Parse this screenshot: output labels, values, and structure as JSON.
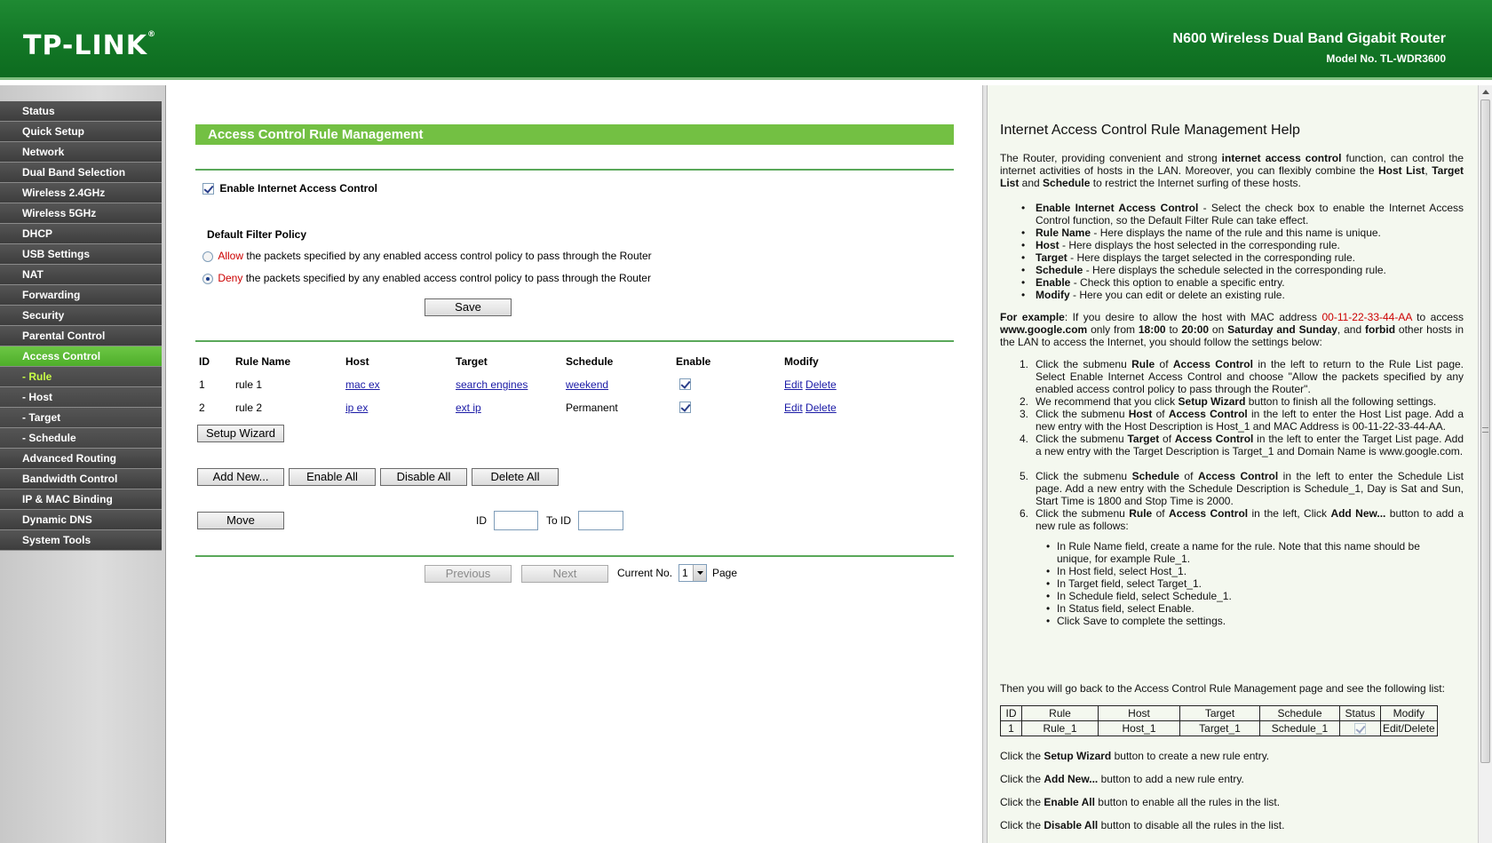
{
  "header": {
    "logo": "TP-LINK",
    "logo_mark": "®",
    "product": "N600 Wireless Dual Band Gigabit Router",
    "model": "Model No. TL-WDR3600"
  },
  "sidebar": {
    "items": [
      {
        "label": "Status"
      },
      {
        "label": "Quick Setup"
      },
      {
        "label": "Network"
      },
      {
        "label": "Dual Band Selection"
      },
      {
        "label": "Wireless 2.4GHz"
      },
      {
        "label": "Wireless 5GHz"
      },
      {
        "label": "DHCP"
      },
      {
        "label": "USB Settings"
      },
      {
        "label": "NAT"
      },
      {
        "label": "Forwarding"
      },
      {
        "label": "Security"
      },
      {
        "label": "Parental Control"
      },
      {
        "label": "Access Control"
      },
      {
        "label": "- Rule"
      },
      {
        "label": "- Host"
      },
      {
        "label": "- Target"
      },
      {
        "label": "- Schedule"
      },
      {
        "label": "Advanced Routing"
      },
      {
        "label": "Bandwidth Control"
      },
      {
        "label": "IP & MAC Binding"
      },
      {
        "label": "Dynamic DNS"
      },
      {
        "label": "System Tools"
      }
    ]
  },
  "main": {
    "title": "Access Control Rule Management",
    "enable_label": "Enable Internet Access Control",
    "enable_checked": true,
    "policy_heading": "Default Filter Policy",
    "allow_word": "Allow",
    "allow_text": " the packets specified by any enabled access control policy to pass through the Router",
    "deny_word": "Deny",
    "deny_text": " the packets specified by any enabled access control policy to pass through the Router",
    "policy_selected": "deny",
    "save_label": "Save",
    "table": {
      "headers": [
        "ID",
        "Rule Name",
        "Host",
        "Target",
        "Schedule",
        "Enable",
        "Modify"
      ],
      "rows": [
        {
          "id": "1",
          "rule": "rule 1",
          "host": "mac ex",
          "target": "search engines",
          "schedule": "weekend",
          "schedule_link": true,
          "enabled": true,
          "edit": "Edit",
          "delete": "Delete"
        },
        {
          "id": "2",
          "rule": "rule 2",
          "host": "ip ex",
          "target": "ext ip",
          "schedule": "Permanent",
          "schedule_link": false,
          "enabled": true,
          "edit": "Edit",
          "delete": "Delete"
        }
      ]
    },
    "setup_wizard_label": "Setup Wizard",
    "add_new_label": "Add New...",
    "enable_all_label": "Enable All",
    "disable_all_label": "Disable All",
    "delete_all_label": "Delete All",
    "move_label": "Move",
    "id_label": "ID",
    "to_id_label": "To ID",
    "previous_label": "Previous",
    "next_label": "Next",
    "current_no_label": "Current No.",
    "current_page": "1",
    "page_label": "Page"
  },
  "help": {
    "title": "Internet Access Control Rule Management Help",
    "intro_1": "The Router, providing convenient and strong ",
    "intro_b1": "internet access control",
    "intro_2": " function, can control the internet activities of hosts in the LAN. Moreover, you can flexibly combine the ",
    "intro_b2": "Host List",
    "intro_3": ", ",
    "intro_b3": "Target List",
    "intro_4": " and ",
    "intro_b4": "Schedule",
    "intro_5": " to restrict the Internet surfing of these hosts.",
    "bullets": [
      {
        "b": "Enable Internet Access Control",
        "t": " - Select the check box to enable the Internet Access Control function, so the Default Filter Rule can take effect."
      },
      {
        "b": "Rule Name",
        "t": " - Here displays the name of the rule and this name is unique."
      },
      {
        "b": "Host",
        "t": " - Here displays the host selected in the corresponding rule."
      },
      {
        "b": "Target",
        "t": " - Here displays the target selected in the corresponding rule."
      },
      {
        "b": "Schedule",
        "t": " - Here displays the schedule selected in the corresponding rule."
      },
      {
        "b": "Enable",
        "t": " - Check this option to enable a specific entry."
      },
      {
        "b": "Modify",
        "t": " - Here you can edit or delete an existing rule."
      }
    ],
    "example_b": "For example",
    "example_1": ": If you desire to allow the host with MAC address ",
    "example_mac": "00-11-22-33-44-AA",
    "example_2": " to access ",
    "example_b2": "www.google.com",
    "example_3": " only from ",
    "example_b3": "18:00",
    "example_4": " to ",
    "example_b4": "20:00",
    "example_5": " on ",
    "example_b5": "Saturday and Sunday",
    "example_6": ", and ",
    "example_b6": "forbid",
    "example_7": " other hosts in the LAN to access the Internet, you should follow the settings below:",
    "steps": [
      {
        "a": "Click the submenu ",
        "b1": "Rule",
        "m": " of ",
        "b2": "Access Control",
        "c": " in the left to return to the Rule List page. Select Enable Internet Access Control and choose \"Allow the packets specified by any enabled access control policy to pass through the Router\"."
      },
      {
        "a": "We recommend that you click ",
        "b1": "Setup Wizard",
        "m": " button to finish all the following settings.",
        "b2": "",
        "c": ""
      },
      {
        "a": "Click the submenu ",
        "b1": "Host",
        "m": " of ",
        "b2": "Access Control",
        "c": " in the left to enter the Host List page. Add a new entry with the Host Description is Host_1 and MAC Address is 00-11-22-33-44-AA."
      },
      {
        "a": "Click the submenu ",
        "b1": "Target",
        "m": " of ",
        "b2": "Access Control",
        "c": " in the left to enter the Target List page. Add a new entry with the Target Description is Target_1 and Domain Name is www.google.com."
      },
      {
        "a": "Click the submenu ",
        "b1": "Schedule",
        "m": " of ",
        "b2": "Access Control",
        "c": " in the left to enter the Schedule List page. Add a new entry with the Schedule Description is Schedule_1, Day is Sat and Sun, Start Time is 1800 and Stop Time is 2000."
      },
      {
        "a": "Click the submenu ",
        "b1": "Rule",
        "m": " of ",
        "b2": "Access Control",
        "c": " in the left, Click "
      }
    ],
    "step6_b3": "Add New...",
    "step6_end": " button to add a new rule as follows:",
    "sub_bullets": [
      "In Rule Name field, create a name for the rule. Note that this name should be unique, for example Rule_1.",
      "In Host field, select Host_1.",
      "In Target field, select Target_1.",
      "In Schedule field, select Schedule_1.",
      "In Status field, select Enable.",
      "Click Save to complete the settings."
    ],
    "then_text": "Then you will go back to the Access Control Rule Management page and see the following list:",
    "table_headers": [
      "ID",
      "Rule",
      "Host",
      "Target",
      "Schedule",
      "Status",
      "Modify"
    ],
    "table_row": [
      "1",
      "Rule_1",
      "Host_1",
      "Target_1",
      "Schedule_1",
      "",
      "Edit/Delete"
    ],
    "click_lines": [
      {
        "a": "Click the ",
        "b": "Setup Wizard",
        "c": " button to create a new rule entry."
      },
      {
        "a": "Click the ",
        "b": "Add New...",
        "c": " button to add a new rule entry."
      },
      {
        "a": "Click the ",
        "b": "Enable All",
        "c": " button to enable all the rules in the list."
      },
      {
        "a": "Click the ",
        "b": "Disable All",
        "c": " button to disable all the rules in the list."
      }
    ]
  }
}
